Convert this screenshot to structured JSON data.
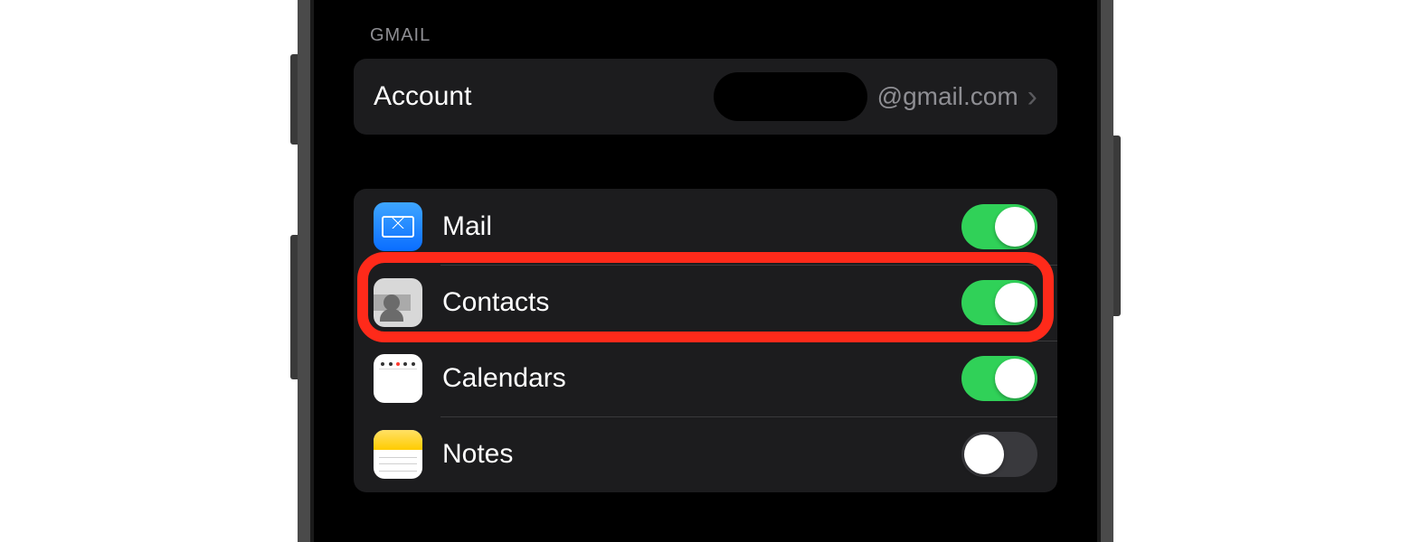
{
  "section_header": "GMAIL",
  "account": {
    "label": "Account",
    "value": "@gmail.com"
  },
  "services": [
    {
      "key": "mail",
      "label": "Mail",
      "enabled": true,
      "highlighted": false,
      "icon": "mail"
    },
    {
      "key": "contacts",
      "label": "Contacts",
      "enabled": true,
      "highlighted": true,
      "icon": "contacts"
    },
    {
      "key": "calendars",
      "label": "Calendars",
      "enabled": true,
      "highlighted": false,
      "icon": "calendars"
    },
    {
      "key": "notes",
      "label": "Notes",
      "enabled": false,
      "highlighted": false,
      "icon": "notes"
    }
  ]
}
